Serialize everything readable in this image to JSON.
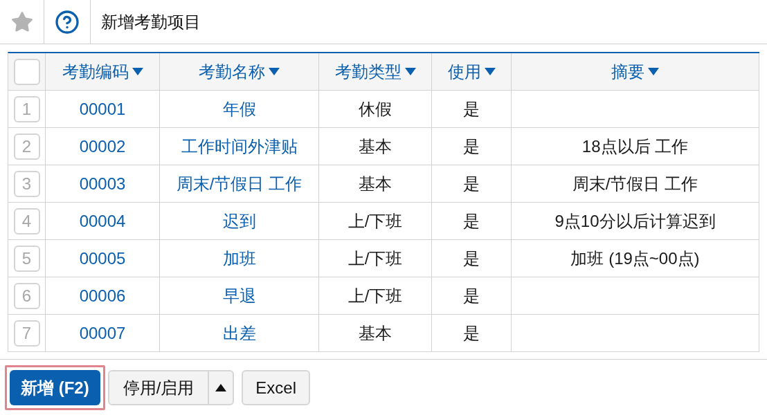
{
  "toolbar": {
    "title": "新增考勤项目"
  },
  "table": {
    "select_all": {
      "checked": false
    },
    "columns": [
      {
        "label": "考勤编码"
      },
      {
        "label": "考勤名称"
      },
      {
        "label": "考勤类型"
      },
      {
        "label": "使用"
      },
      {
        "label": "摘要"
      }
    ],
    "rows": [
      {
        "number": "1",
        "code": "00001",
        "name": "年假",
        "type": "休假",
        "in_use": "是"
      },
      {
        "number": "2",
        "code": "00002",
        "name": "工作时间外津贴",
        "type": "基本",
        "in_use": "是",
        "summary": "18点以后 工作"
      },
      {
        "number": "3",
        "code": "00003",
        "name": "周末/节假日 工作",
        "type": "基本",
        "in_use": "是",
        "summary": "周末/节假日 工作"
      },
      {
        "number": "4",
        "code": "00004",
        "name": "迟到",
        "type": "上/下班",
        "in_use": "是",
        "summary": "9点10分以后计算迟到"
      },
      {
        "number": "5",
        "code": "00005",
        "name": "加班",
        "type": "上/下班",
        "in_use": "是",
        "summary": "加班 (19点~00点)"
      },
      {
        "number": "6",
        "code": "00006",
        "name": "早退",
        "type": "上/下班",
        "in_use": "是"
      },
      {
        "number": "7",
        "code": "00007",
        "name": "出差",
        "type": "基本",
        "in_use": "是"
      }
    ]
  },
  "buttons": [
    {
      "kind": "primary",
      "label": "新增 (F2)",
      "focused": true
    },
    {
      "kind": "split",
      "label": "停用/启用",
      "focused": false
    },
    {
      "kind": "plain",
      "label": "Excel",
      "focused": false
    }
  ]
}
